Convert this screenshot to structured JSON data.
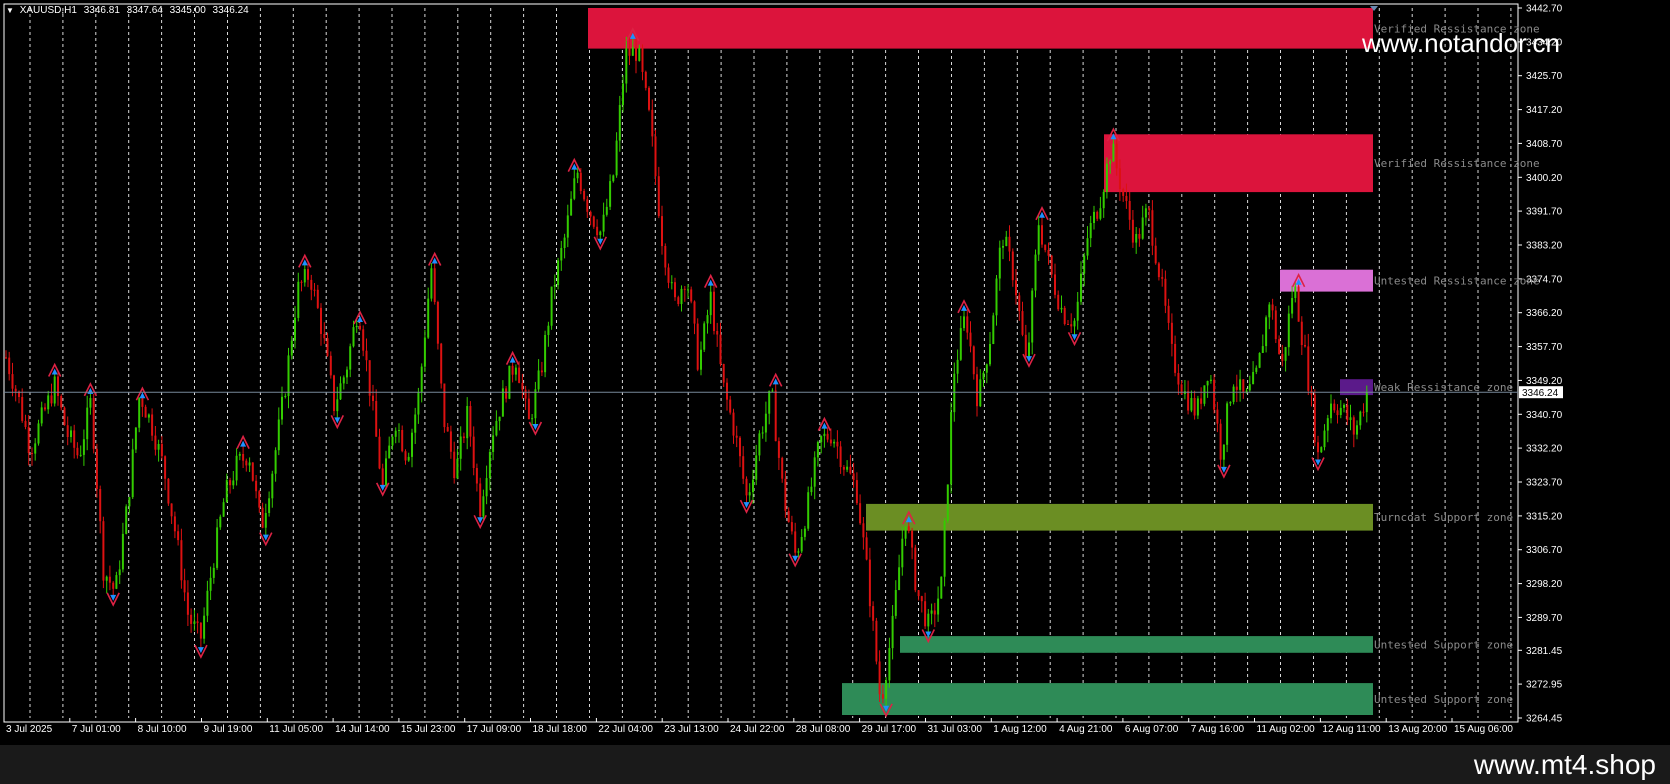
{
  "header": {
    "symbol": "XAUUSD,H1",
    "open": "3346.81",
    "high": "3347.64",
    "low": "3345.00",
    "close": "3346.24"
  },
  "watermark": "www.notandor.cn",
  "footer_text": "www.mt4.shop",
  "colors": {
    "background": "#000000",
    "bull": "#33cc00",
    "bear": "#dd1111",
    "axis": "#ffffff",
    "grid": "#ffffff",
    "price_line": "#778899",
    "resistance_verified": "#dc143c",
    "resistance_untested": "#da70d6",
    "resistance_weak": "#5b1a8a",
    "support_turncoat": "#6b8e23",
    "support_untested": "#2e8b57",
    "zone_label": "#8a8a8a",
    "fractal_up": "#1e90ff",
    "fractal_down": "#1e90ff"
  },
  "chart_data": {
    "type": "candlestick",
    "symbol": "XAUUSD",
    "timeframe": "H1",
    "y_range": [
      3264.45,
      3442.7
    ],
    "y_ticks": [
      "3442.70",
      "3434.20",
      "3425.70",
      "3417.20",
      "3408.70",
      "3400.20",
      "3391.70",
      "3383.20",
      "3374.70",
      "3366.20",
      "3357.70",
      "3349.20",
      "3340.70",
      "3332.20",
      "3323.70",
      "3315.20",
      "3306.70",
      "3298.20",
      "3289.70",
      "3281.45",
      "3272.95",
      "3264.45"
    ],
    "current_price": "3346.24",
    "x_labels": [
      "3 Jul 2025",
      "7 Jul 01:00",
      "8 Jul 10:00",
      "9 Jul 19:00",
      "11 Jul 05:00",
      "14 Jul 14:00",
      "15 Jul 23:00",
      "17 Jul 09:00",
      "18 Jul 18:00",
      "22 Jul 04:00",
      "23 Jul 13:00",
      "24 Jul 22:00",
      "28 Jul 08:00",
      "29 Jul 17:00",
      "31 Jul 03:00",
      "1 Aug 12:00",
      "4 Aug 21:00",
      "6 Aug 07:00",
      "7 Aug 16:00",
      "11 Aug 02:00",
      "12 Aug 11:00",
      "13 Aug 20:00",
      "15 Aug 06:00"
    ],
    "price_path": [
      3355,
      3345,
      3332,
      3340,
      3348,
      3336,
      3330,
      3344,
      3302,
      3296,
      3318,
      3346,
      3338,
      3327,
      3310,
      3290,
      3284,
      3303,
      3320,
      3328,
      3331,
      3312,
      3328,
      3348,
      3372,
      3376,
      3362,
      3343,
      3352,
      3368,
      3346,
      3322,
      3340,
      3330,
      3346,
      3378,
      3340,
      3326,
      3341,
      3317,
      3336,
      3346,
      3355,
      3338,
      3351,
      3372,
      3385,
      3402,
      3392,
      3386,
      3401,
      3431,
      3432,
      3414,
      3385,
      3368,
      3376,
      3353,
      3370,
      3348,
      3336,
      3319,
      3335,
      3346,
      3320,
      3305,
      3318,
      3334,
      3336,
      3328,
      3322,
      3298,
      3268,
      3288,
      3316,
      3296,
      3287,
      3298,
      3351,
      3366,
      3344,
      3360,
      3386,
      3375,
      3352,
      3389,
      3376,
      3366,
      3364,
      3385,
      3394,
      3408,
      3395,
      3384,
      3392,
      3375,
      3355,
      3346,
      3341,
      3353,
      3331,
      3350,
      3344,
      3351,
      3370,
      3352,
      3374,
      3354,
      3330,
      3344,
      3342,
      3336,
      3346
    ]
  },
  "zones": [
    {
      "label": "Verified Ressistance zone",
      "top": 3442.7,
      "bottom": 3432.5,
      "start": "22 Jul 04:00",
      "color": "#dc143c"
    },
    {
      "label": "Verified Ressistance zone",
      "top": 3411.0,
      "bottom": 3396.5,
      "start": "7 Aug 16:00",
      "color": "#dc143c"
    },
    {
      "label": "Untested Ressistance zone",
      "top": 3377.0,
      "bottom": 3371.5,
      "start": "13 Aug 20:00",
      "color": "#da70d6"
    },
    {
      "label": "Weak Ressistance zone",
      "top": 3349.5,
      "bottom": 3345.5,
      "start": "15 Aug 06:00",
      "color": "#5b1a8a"
    },
    {
      "label": "Turncoat Support zone",
      "top": 3318.2,
      "bottom": 3311.5,
      "start": "31 Jul 03:00",
      "color": "#6b8e23"
    },
    {
      "label": "Untested Support zone",
      "top": 3285.0,
      "bottom": 3280.8,
      "start": "31 Jul 03:00",
      "color": "#2e8b57"
    },
    {
      "label": "Untested Support zone",
      "top": 3273.2,
      "bottom": 3265.2,
      "start": "31 Jul 03:00",
      "color": "#2e8b57"
    }
  ]
}
